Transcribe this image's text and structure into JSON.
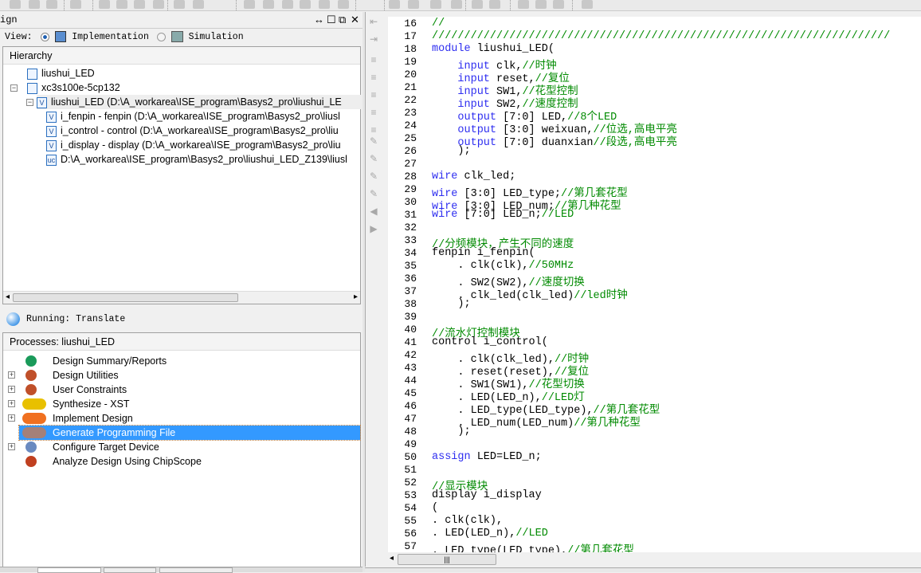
{
  "design_panel": {
    "title": "ign",
    "view_label": "View:",
    "implementation": "Implementation",
    "simulation": "Simulation",
    "view_selected": "Implementation",
    "controls": [
      "↔",
      "☐",
      "⧉",
      "✕"
    ]
  },
  "hierarchy": {
    "header": "Hierarchy",
    "items": [
      {
        "label": "liushui_LED",
        "icon": "project-icon"
      },
      {
        "label": "xc3s100e-5cp132",
        "icon": "chip-icon"
      },
      {
        "label": "liushui_LED (D:\\A_workarea\\ISE_program\\Basys2_pro\\liushui_LE",
        "icon": "verilog-top-icon"
      },
      {
        "label": "i_fenpin - fenpin (D:\\A_workarea\\ISE_program\\Basys2_pro\\liusl",
        "icon": "verilog-icon"
      },
      {
        "label": "i_control - control (D:\\A_workarea\\ISE_program\\Basys2_pro\\liu",
        "icon": "verilog-icon"
      },
      {
        "label": "i_display - display (D:\\A_workarea\\ISE_program\\Basys2_pro\\liu",
        "icon": "verilog-icon"
      },
      {
        "label": "D:\\A_workarea\\ISE_program\\Basys2_pro\\liushui_LED_Z139\\liusl",
        "icon": "ucf-icon"
      }
    ]
  },
  "status": {
    "text": "Running: Translate"
  },
  "processes": {
    "header": "Processes: liushui_LED",
    "selected": "Generate Programming File",
    "items": [
      {
        "label": "Design Summary/Reports",
        "icon": "sigma-icon",
        "expand": false
      },
      {
        "label": "Design Utilities",
        "icon": "tools-icon",
        "expand": true
      },
      {
        "label": "User Constraints",
        "icon": "tools-icon",
        "expand": true
      },
      {
        "label": "Synthesize - XST",
        "icon": "warning-icon",
        "expand": true
      },
      {
        "label": "Implement Design",
        "icon": "question-icon",
        "expand": true
      },
      {
        "label": "Generate Programming File",
        "icon": "question-icon",
        "expand": false
      },
      {
        "label": "Configure Target Device",
        "icon": "device-icon",
        "expand": true
      },
      {
        "label": "Analyze Design Using ChipScope",
        "icon": "chipscope-icon",
        "expand": false
      }
    ]
  },
  "colors": {
    "keyword": "#2e2ef0",
    "comment": "#008a00",
    "selection": "#3399ff"
  },
  "editor": {
    "lines": [
      {
        "n": "16",
        "s": [
          [
            "c",
            "//"
          ]
        ]
      },
      {
        "n": "17",
        "s": [
          [
            "c",
            "///////////////////////////////////////////////////////////////////////"
          ]
        ]
      },
      {
        "n": "18",
        "s": [
          [
            "k",
            "module"
          ],
          [
            "t",
            " liushui_LED("
          ]
        ]
      },
      {
        "n": "19",
        "s": [
          [
            "t",
            "    "
          ],
          [
            "k",
            "input"
          ],
          [
            "t",
            " clk,"
          ],
          [
            "c",
            "//时钟"
          ]
        ]
      },
      {
        "n": "20",
        "s": [
          [
            "t",
            "    "
          ],
          [
            "k",
            "input"
          ],
          [
            "t",
            " reset,"
          ],
          [
            "c",
            "//复位"
          ]
        ]
      },
      {
        "n": "21",
        "s": [
          [
            "t",
            "    "
          ],
          [
            "k",
            "input"
          ],
          [
            "t",
            " SW1,"
          ],
          [
            "c",
            "//花型控制"
          ]
        ]
      },
      {
        "n": "22",
        "s": [
          [
            "t",
            "    "
          ],
          [
            "k",
            "input"
          ],
          [
            "t",
            " SW2,"
          ],
          [
            "c",
            "//速度控制"
          ]
        ]
      },
      {
        "n": "23",
        "s": [
          [
            "t",
            "    "
          ],
          [
            "k",
            "output"
          ],
          [
            "t",
            " [7:0] LED,"
          ],
          [
            "c",
            "//8个LED"
          ]
        ]
      },
      {
        "n": "24",
        "s": [
          [
            "t",
            "    "
          ],
          [
            "k",
            "output"
          ],
          [
            "t",
            " [3:0] weixuan,"
          ],
          [
            "c",
            "//位选,高电平亮"
          ]
        ]
      },
      {
        "n": "25",
        "s": [
          [
            "t",
            "    "
          ],
          [
            "k",
            "output"
          ],
          [
            "t",
            " [7:0] duanxian"
          ],
          [
            "c",
            "//段选,高电平亮"
          ]
        ]
      },
      {
        "n": "26",
        "s": [
          [
            "t",
            "    );"
          ]
        ]
      },
      {
        "n": "27",
        "s": []
      },
      {
        "n": "28",
        "s": [
          [
            "k",
            "wire"
          ],
          [
            "t",
            " clk_led;"
          ]
        ]
      },
      {
        "n": "29",
        "s": [
          [
            "k",
            "wire"
          ],
          [
            "t",
            " [3:0] LED_type;"
          ],
          [
            "c",
            "//第几套花型"
          ]
        ]
      },
      {
        "n": "30",
        "s": [
          [
            "k",
            "wire"
          ],
          [
            "t",
            " [3:0] LED_num;"
          ],
          [
            "c",
            "//第几种花型"
          ]
        ]
      },
      {
        "n": "31",
        "s": [
          [
            "k",
            "wire"
          ],
          [
            "t",
            " [7:0] LED_n;"
          ],
          [
            "c",
            "//LED"
          ]
        ]
      },
      {
        "n": "32",
        "s": []
      },
      {
        "n": "33",
        "s": [
          [
            "c",
            "//分频模块，产生不同的速度"
          ]
        ]
      },
      {
        "n": "34",
        "s": [
          [
            "t",
            "fenpin i_fenpin("
          ]
        ]
      },
      {
        "n": "35",
        "s": [
          [
            "t",
            "    . clk(clk),"
          ],
          [
            "c",
            "//50MHz"
          ]
        ]
      },
      {
        "n": "36",
        "s": [
          [
            "t",
            "    . SW2(SW2),"
          ],
          [
            "c",
            "//速度切换"
          ]
        ]
      },
      {
        "n": "37",
        "s": [
          [
            "t",
            "    . clk_led(clk_led)"
          ],
          [
            "c",
            "//led时钟"
          ]
        ]
      },
      {
        "n": "38",
        "s": [
          [
            "t",
            "    );"
          ]
        ]
      },
      {
        "n": "39",
        "s": []
      },
      {
        "n": "40",
        "s": [
          [
            "c",
            "//流水灯控制模块"
          ]
        ]
      },
      {
        "n": "41",
        "s": [
          [
            "t",
            "control i_control("
          ]
        ]
      },
      {
        "n": "42",
        "s": [
          [
            "t",
            "    . clk(clk_led),"
          ],
          [
            "c",
            "//时钟"
          ]
        ]
      },
      {
        "n": "43",
        "s": [
          [
            "t",
            "    . reset(reset),"
          ],
          [
            "c",
            "//复位"
          ]
        ]
      },
      {
        "n": "44",
        "s": [
          [
            "t",
            "    . SW1(SW1),"
          ],
          [
            "c",
            "//花型切换"
          ]
        ]
      },
      {
        "n": "45",
        "s": [
          [
            "t",
            "    . LED(LED_n),"
          ],
          [
            "c",
            "//LED灯"
          ]
        ]
      },
      {
        "n": "46",
        "s": [
          [
            "t",
            "    . LED_type(LED_type),"
          ],
          [
            "c",
            "//第几套花型"
          ]
        ]
      },
      {
        "n": "47",
        "s": [
          [
            "t",
            "    . LED_num(LED_num)"
          ],
          [
            "c",
            "//第几种花型"
          ]
        ]
      },
      {
        "n": "48",
        "s": [
          [
            "t",
            "    );"
          ]
        ]
      },
      {
        "n": "49",
        "s": []
      },
      {
        "n": "50",
        "s": [
          [
            "k",
            "assign"
          ],
          [
            "t",
            " LED=LED_n;"
          ]
        ]
      },
      {
        "n": "51",
        "s": []
      },
      {
        "n": "52",
        "s": [
          [
            "c",
            "//显示模块"
          ]
        ]
      },
      {
        "n": "53",
        "s": [
          [
            "t",
            "display i_display"
          ]
        ]
      },
      {
        "n": "54",
        "s": [
          [
            "t",
            "("
          ]
        ]
      },
      {
        "n": "55",
        "s": [
          [
            "t",
            ". clk(clk),"
          ]
        ]
      },
      {
        "n": "56",
        "s": [
          [
            "t",
            ". LED(LED_n),"
          ],
          [
            "c",
            "//LED"
          ]
        ]
      },
      {
        "n": "57",
        "s": [
          [
            "t",
            ". LED_type(LED_type),"
          ],
          [
            "c",
            "//第几套花型"
          ]
        ]
      }
    ]
  }
}
